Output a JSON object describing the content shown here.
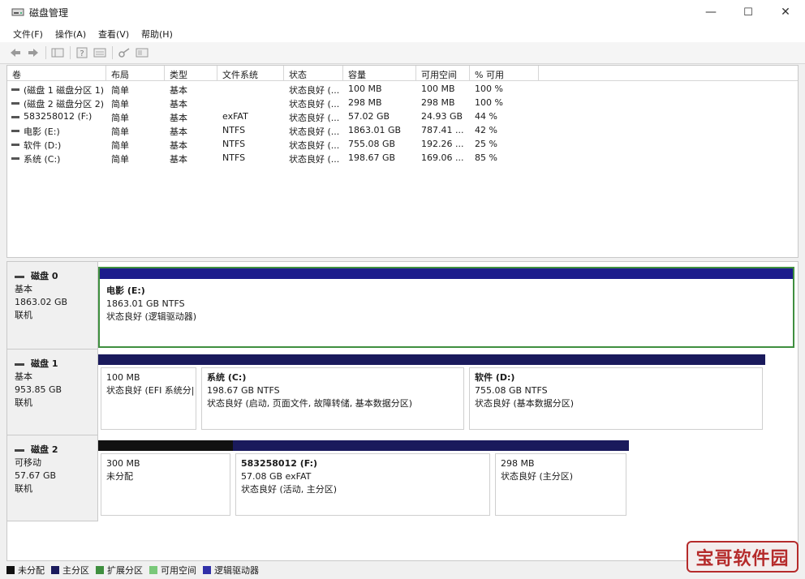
{
  "window": {
    "title": "磁盘管理",
    "controls": {
      "minimize": "—",
      "maximize": "☐",
      "close": "✕"
    }
  },
  "menu": [
    "文件(F)",
    "操作(A)",
    "查看(V)",
    "帮助(H)"
  ],
  "toolbar": {
    "icons": [
      "back-arrow-icon",
      "forward-arrow-icon",
      "console-tree-icon",
      "help-icon",
      "properties-icon",
      "key-icon",
      "view-icon"
    ]
  },
  "volume_list": {
    "columns": [
      "卷",
      "布局",
      "类型",
      "文件系统",
      "状态",
      "容量",
      "可用空间",
      "% 可用"
    ],
    "rows": [
      [
        "(磁盘 1 磁盘分区 1)",
        "简单",
        "基本",
        "",
        "状态良好 (...",
        "100 MB",
        "100 MB",
        "100 %"
      ],
      [
        "(磁盘 2 磁盘分区 2)",
        "简单",
        "基本",
        "",
        "状态良好 (...",
        "298 MB",
        "298 MB",
        "100 %"
      ],
      [
        "583258012 (F:)",
        "简单",
        "基本",
        "exFAT",
        "状态良好 (...",
        "57.02 GB",
        "24.93 GB",
        "44 %"
      ],
      [
        "电影 (E:)",
        "简单",
        "基本",
        "NTFS",
        "状态良好 (...",
        "1863.01 GB",
        "787.41 ...",
        "42 %"
      ],
      [
        "软件 (D:)",
        "简单",
        "基本",
        "NTFS",
        "状态良好 (...",
        "755.08 GB",
        "192.26 ...",
        "25 %"
      ],
      [
        "系统 (C:)",
        "简单",
        "基本",
        "NTFS",
        "状态良好 (...",
        "198.67 GB",
        "169.06 ...",
        "85 %"
      ]
    ]
  },
  "disks": [
    {
      "name": "磁盘 0",
      "type": "基本",
      "size": "1863.02 GB",
      "status": "联机",
      "partitions": [
        {
          "name": "电影 (E:)",
          "size": "1863.01 GB NTFS",
          "status": "状态良好 (逻辑驱动器)",
          "color": "#1c1c8c"
        }
      ]
    },
    {
      "name": "磁盘 1",
      "type": "基本",
      "size": "953.85 GB",
      "status": "联机",
      "partitions": [
        {
          "name": "",
          "size": "100 MB",
          "status": "状态良好 (EFI 系统分|",
          "color": "#1a1a5c"
        },
        {
          "name": "系统 (C:)",
          "size": "198.67 GB NTFS",
          "status": "状态良好 (启动, 页面文件, 故障转储, 基本数据分区)",
          "color": "#1a1a5c"
        },
        {
          "name": "软件 (D:)",
          "size": "755.08 GB NTFS",
          "status": "状态良好 (基本数据分区)",
          "color": "#1a1a5c"
        }
      ]
    },
    {
      "name": "磁盘 2",
      "type": "可移动",
      "size": "57.67 GB",
      "status": "联机",
      "partitions": [
        {
          "name": "",
          "size": "300 MB",
          "status": "未分配",
          "color": "#111111"
        },
        {
          "name": "583258012 (F:)",
          "size": "57.08 GB exFAT",
          "status": "状态良好 (活动, 主分区)",
          "color": "#1a1a5c"
        },
        {
          "name": "",
          "size": "298 MB",
          "status": "状态良好 (主分区)",
          "color": "#1a1a5c"
        }
      ]
    }
  ],
  "legend": [
    {
      "label": "未分配",
      "color": "#111111"
    },
    {
      "label": "主分区",
      "color": "#1a1a5c"
    },
    {
      "label": "扩展分区",
      "color": "#3f8f3f"
    },
    {
      "label": "可用空间",
      "color": "#79c879"
    },
    {
      "label": "逻辑驱动器",
      "color": "#3030a8"
    }
  ],
  "watermark": "宝哥软件园"
}
